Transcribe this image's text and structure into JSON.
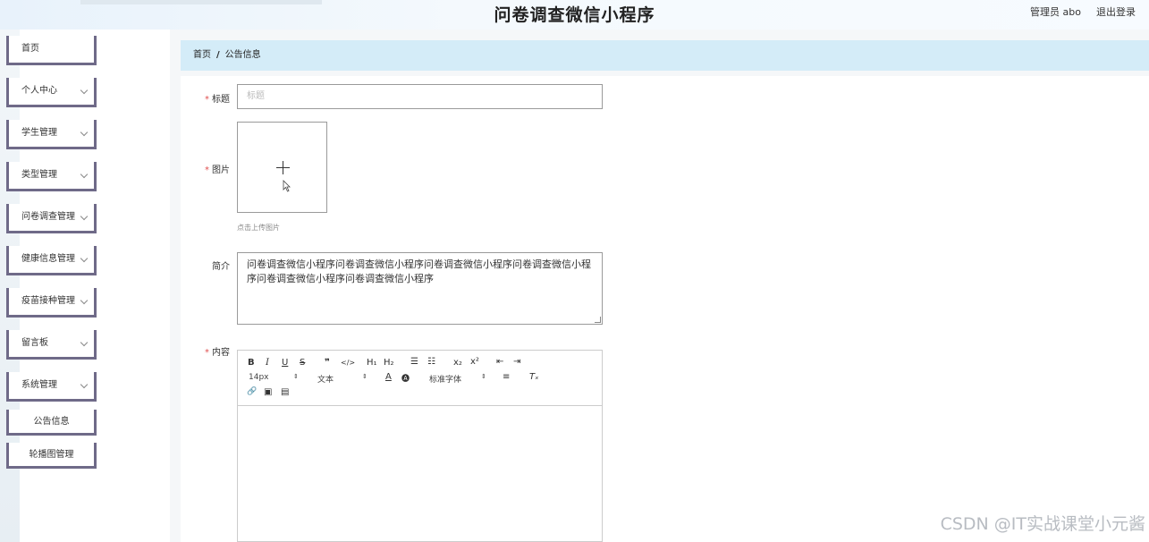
{
  "header": {
    "title": "问卷调查微信小程序",
    "user": "管理员 abo",
    "logout": "退出登录"
  },
  "sidebar": {
    "items": [
      {
        "label": "首页",
        "has_children": false
      },
      {
        "label": "个人中心",
        "has_children": true
      },
      {
        "label": "学生管理",
        "has_children": true
      },
      {
        "label": "类型管理",
        "has_children": true
      },
      {
        "label": "问卷调查管理",
        "has_children": true
      },
      {
        "label": "健康信息管理",
        "has_children": true
      },
      {
        "label": "疫苗接种管理",
        "has_children": true
      },
      {
        "label": "留言板",
        "has_children": true
      },
      {
        "label": "系统管理",
        "has_children": true
      }
    ],
    "sub_items": [
      "公告信息",
      "轮播图管理"
    ]
  },
  "breadcrumb": {
    "home": "首页",
    "separator": "/",
    "current": "公告信息"
  },
  "form": {
    "title_label": "标题",
    "title_placeholder": "标题",
    "image_label": "图片",
    "upload_hint": "点击上传图片",
    "intro_label": "简介",
    "intro_value": "问卷调查微信小程序问卷调查微信小程序问卷调查微信小程序问卷调查微信小程序问卷调查微信小程序问卷调查微信小程序",
    "content_label": "内容",
    "required_mark": "*"
  },
  "editor": {
    "buttons": {
      "bold": "B",
      "italic": "I",
      "underline": "U",
      "strike": "S",
      "quote": "❞",
      "code": "</>",
      "h1": "H₁",
      "h2": "H₂",
      "ordered_list": "☰",
      "bullet_list": "☷",
      "subscript": "x₂",
      "superscript": "x²",
      "outdent": "⇤",
      "indent": "⇥",
      "font_color": "A",
      "background": "🅐",
      "align": "≡",
      "clean": "Tₓ",
      "link": "🔗",
      "image": "▣",
      "video": "▤"
    },
    "size_value": "14px",
    "header_value": "文本",
    "font_value": "标准字体"
  },
  "watermark": "CSDN @IT实战课堂小元酱",
  "colors": {
    "sidebar_border": "#6f6a88",
    "breadcrumb_bg": "#d4ecf8",
    "required": "#e05050"
  }
}
